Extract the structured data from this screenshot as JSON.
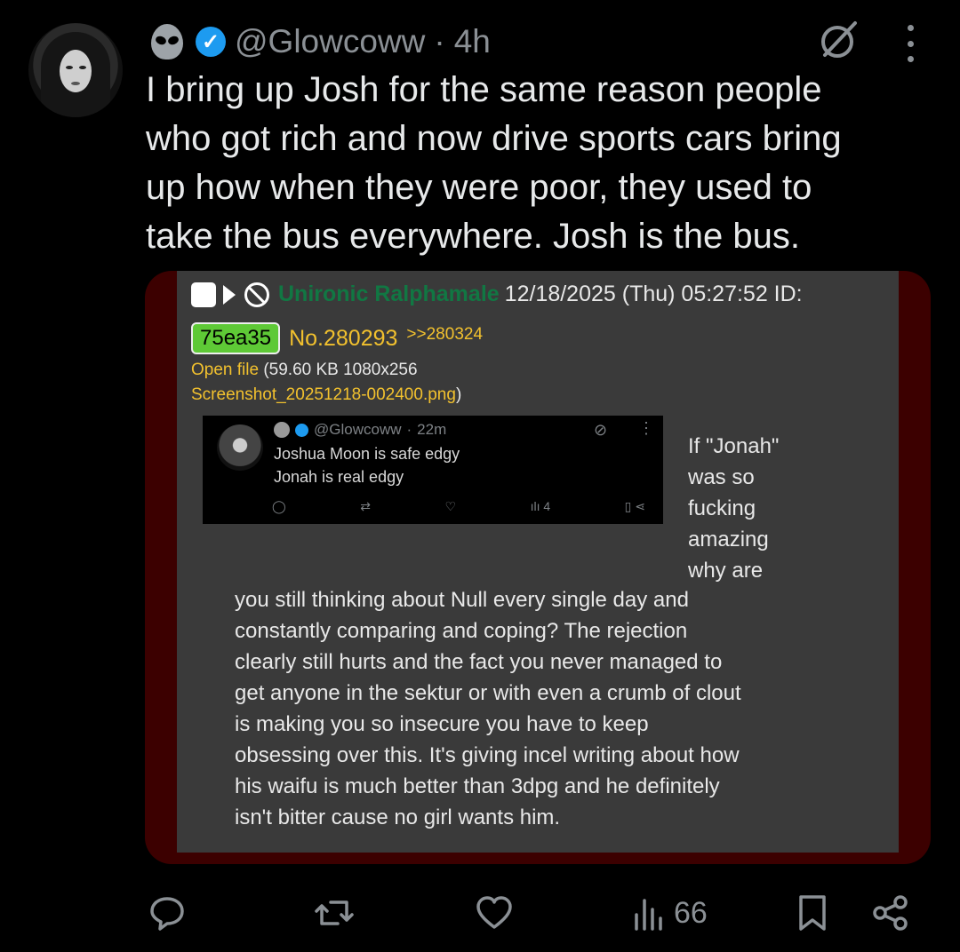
{
  "tweet": {
    "handle": "@Glowcoww",
    "separator": "·",
    "time": "4h",
    "text": "I bring up Josh for the same reason people\nwho got rich and now drive sports cars bring\nup how when they were poor, they used to\ntake the bus everywhere. Josh is the bus."
  },
  "embed": {
    "poster_name": "Unironic Ralphamale",
    "datetime": "12/18/2025 (Thu) 05:27:52 ID:",
    "id_badge": "75ea35",
    "post_no": "No.280293",
    "reply_link": ">>280324",
    "open_file": "Open file",
    "file_meta": " (59.60 KB 1080x256",
    "file_name": "Screenshot_20251218-002400.png",
    "file_close": ")",
    "side_text": "If \"Jonah\"\nwas so\nfucking\namazing\nwhy are",
    "body_text": "you still thinking about Null every single day and\nconstantly comparing and coping? The rejection\nclearly still hurts and the fact you never managed to\nget anyone in the sektur or with even a crumb of clout\nis making you so insecure you have to keep\nobsessing over this. It's giving incel writing about how\nhis waifu is much better than 3dpg and he definitely\nisn't bitter cause no girl wants him."
  },
  "screenshot": {
    "handle": "@Glowcoww",
    "separator": "·",
    "time": "22m",
    "text": "Joshua Moon is safe edgy\nJonah is real edgy",
    "views": "4"
  },
  "actions": {
    "views": "66"
  },
  "colors": {
    "background": "#000000",
    "text": "#e7e9ea",
    "muted": "#8b9095",
    "verified": "#1d9bf0",
    "post_bg": "#3a3a3a",
    "media_border": "#3c0000",
    "name_green": "#117743",
    "link_yellow": "#f2c12e",
    "id_green": "#5ec936"
  },
  "icons": [
    "alien-icon",
    "verified-icon",
    "grok-icon",
    "more-icon",
    "reply-icon",
    "retweet-icon",
    "like-icon",
    "views-icon",
    "bookmark-icon",
    "share-icon"
  ]
}
